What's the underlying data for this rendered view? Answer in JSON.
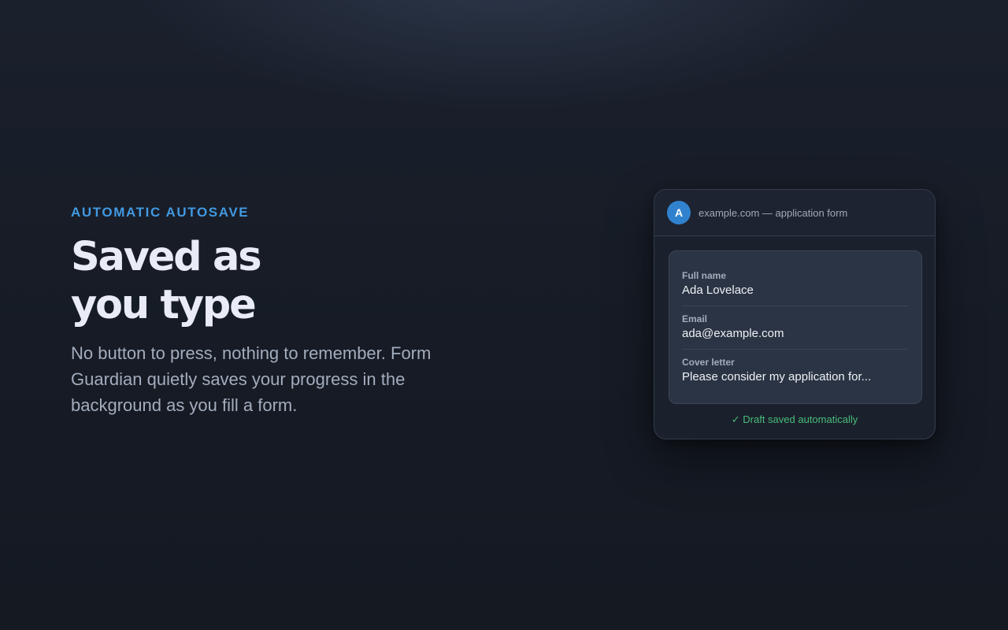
{
  "hero": {
    "eyebrow": "AUTOMATIC AUTOSAVE",
    "headline_line1": "Saved as",
    "headline_line2": "you type",
    "description": "No button to press, nothing to remember. Form Guardian quietly saves your progress in the background as you fill a form."
  },
  "card": {
    "avatar_letter": "A",
    "site_title": "example.com — application form",
    "fields": [
      {
        "label": "Full name",
        "value": "Ada Lovelace"
      },
      {
        "label": "Email",
        "value": "ada@example.com"
      },
      {
        "label": "Cover letter",
        "value": "Please consider my application for..."
      }
    ],
    "status": "✓ Draft saved automatically"
  },
  "colors": {
    "accent": "#4299e1",
    "avatar": "#3182ce",
    "success": "#48bb78",
    "background": "#171c26"
  }
}
